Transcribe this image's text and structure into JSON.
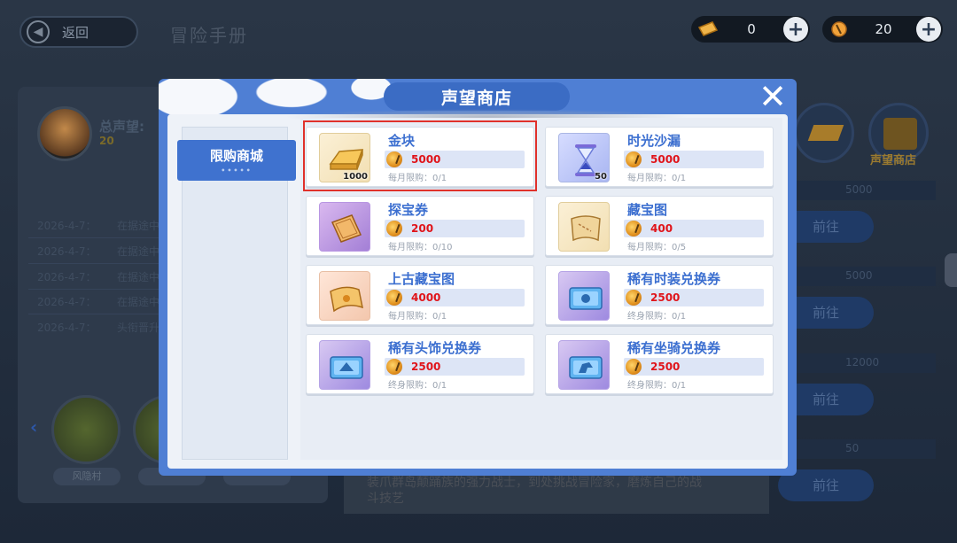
{
  "background": {
    "back_label": "返回",
    "page_title": "冒险手册",
    "currencies": [
      {
        "icon": "gold-ticket-icon",
        "value": "0"
      },
      {
        "icon": "reputation-coin-icon",
        "value": "20"
      }
    ],
    "total_reputation_label": "总声望:",
    "total_reputation_value": "20",
    "log_dates": [
      "2026-4-7：",
      "2026-4-7：",
      "2026-4-7：",
      "2026-4-7：",
      "2026-4-7："
    ],
    "log_texts": [
      "在据途中",
      "在据途中",
      "在据途中",
      "在据途中",
      "头衔晋升"
    ],
    "map_label": "风隐村",
    "shop_label": "声望商店",
    "right_rows": [
      {
        "num": "5000",
        "go": "前往"
      },
      {
        "num": "5000",
        "go": "前往"
      },
      {
        "num": "12000",
        "go": "前往"
      },
      {
        "num": "50",
        "go": "前往"
      }
    ],
    "bottom_text": "装爪群岛颠踊族的强力战士，到处挑战冒险家，磨炼自己的战斗技艺"
  },
  "dialog": {
    "title": "声望商店",
    "close_icon": "close-icon",
    "tabs": [
      {
        "label": "限购商城",
        "active": true
      }
    ],
    "items": [
      {
        "name": "金块",
        "price": "5000",
        "limit": "每月限购：0/1",
        "qty": "1000",
        "icon": "gold-bar-icon",
        "highlighted": true
      },
      {
        "name": "时光沙漏",
        "price": "5000",
        "limit": "每月限购：0/1",
        "qty": "50",
        "icon": "hourglass-icon"
      },
      {
        "name": "探宝券",
        "price": "200",
        "limit": "每月限购：0/10",
        "qty": "",
        "icon": "treasure-ticket-icon"
      },
      {
        "name": "藏宝图",
        "price": "400",
        "limit": "每月限购：0/5",
        "qty": "",
        "icon": "treasure-map-icon"
      },
      {
        "name": "上古藏宝图",
        "price": "4000",
        "limit": "每月限购：0/1",
        "qty": "",
        "icon": "ancient-treasure-map-icon"
      },
      {
        "name": "稀有时装兑换券",
        "price": "2500",
        "limit": "终身限购：0/1",
        "qty": "",
        "icon": "costume-voucher-icon"
      },
      {
        "name": "稀有头饰兑换券",
        "price": "2500",
        "limit": "终身限购：0/1",
        "qty": "",
        "icon": "headwear-voucher-icon"
      },
      {
        "name": "稀有坐骑兑换券",
        "price": "2500",
        "limit": "终身限购：0/1",
        "qty": "",
        "icon": "mount-voucher-icon"
      }
    ]
  },
  "colors": {
    "accent": "#3f72cf",
    "price": "#e0141a",
    "highlight_box": "#e0312b"
  }
}
